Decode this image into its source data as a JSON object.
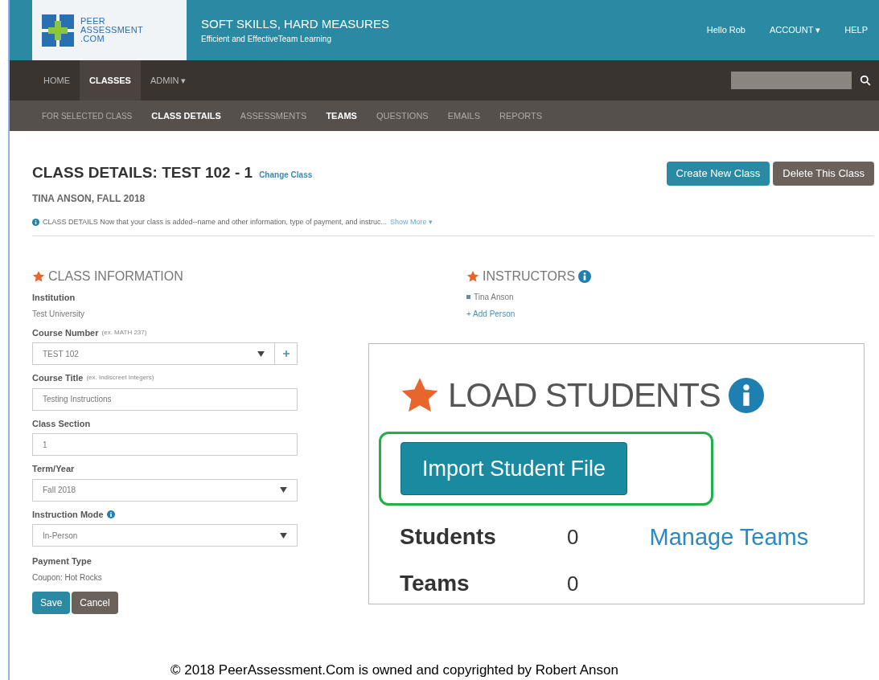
{
  "header": {
    "logo_lines": [
      "PEER",
      "ASSESSMENT",
      ".COM"
    ],
    "tagline": "SOFT SKILLS, HARD MEASURES",
    "subtagline": "Efficient and EffectiveTeam Learning",
    "links": [
      "Hello Rob",
      "ACCOUNT ▾",
      "HELP"
    ]
  },
  "nav": {
    "items": [
      {
        "label": "HOME",
        "selected": false
      },
      {
        "label": "CLASSES",
        "selected": true
      },
      {
        "label": "ADMIN ▾",
        "selected": false
      }
    ]
  },
  "subnav": {
    "label": "FOR SELECTED CLASS",
    "items": [
      {
        "label": "CLASS DETAILS",
        "bold": true
      },
      {
        "label": "ASSESSMENTS",
        "bold": false
      },
      {
        "label": "TEAMS",
        "bold": true
      },
      {
        "label": "QUESTIONS",
        "bold": false
      },
      {
        "label": "EMAILS",
        "bold": false
      },
      {
        "label": "REPORTS",
        "bold": false
      }
    ]
  },
  "page": {
    "title": "CLASS DETAILS: TEST 102 - 1",
    "change_link": "Change Class",
    "subtitle": "TINA ANSON, FALL 2018",
    "buttons": [
      "Create New Class",
      "Delete This Class"
    ],
    "info": "CLASS DETAILS Now that your class is added--name and other information, type of payment, and instruc...",
    "show_more": "Show More ▾"
  },
  "class_information": {
    "heading": "CLASS INFORMATION",
    "institution_label": "Institution",
    "institution": "Test University",
    "fields": [
      {
        "label": "Course Number",
        "hint": "(ex. MATH 237)",
        "value": "TEST 102",
        "kind": "select-add"
      },
      {
        "label": "Course Title",
        "hint": "(ex. Indiscreet Integers)",
        "value": "Testing Instructions",
        "kind": "text"
      },
      {
        "label": "Class Section",
        "value": "1",
        "kind": "text"
      },
      {
        "label": "Term/Year",
        "value": "Fall 2018",
        "kind": "select"
      },
      {
        "label": "Instruction Mode",
        "value": "In-Person",
        "kind": "select",
        "info": true
      }
    ],
    "payment_label": "Payment Type",
    "payment": "Coupon: Hot Rocks",
    "save": "Save",
    "cancel": "Cancel"
  },
  "instructors": {
    "heading": "INSTRUCTORS",
    "people": [
      "Tina Anson"
    ],
    "add": "+ Add Person"
  },
  "load_students": {
    "heading": "LOAD STUDENTS",
    "button": "Import Student File",
    "stats": [
      {
        "label": "Students",
        "value": "0"
      },
      {
        "label": "Teams",
        "value": "0"
      }
    ],
    "manage": "Manage Teams"
  },
  "footer": "© 2018 PeerAssessment.Com is owned and copyrighted by Robert Anson"
}
